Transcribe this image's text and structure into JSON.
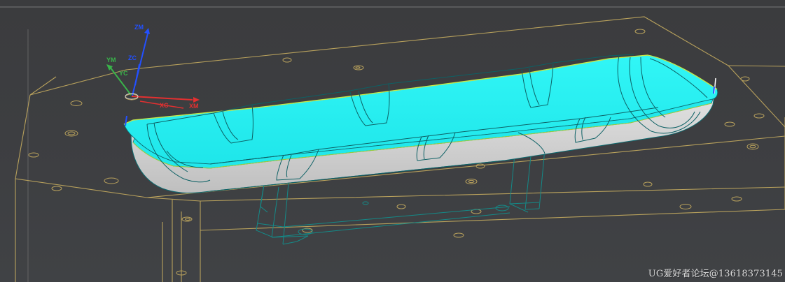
{
  "viewport": {
    "background": "#3c3d3f",
    "box_edge_color": "#b7a15f",
    "part_fill_color": "#28f2f2",
    "part_side_color": "#cfcfcf",
    "part_edge_color": "#0e6b70",
    "wire_color": "#148c8c"
  },
  "triad": {
    "zm": "ZM",
    "zc": "ZC",
    "ym": "YM",
    "yc": "YC",
    "xc": "XC",
    "xm": "XM",
    "x_color": "#e33030",
    "y_color": "#39b34a",
    "z_color": "#2350ff"
  },
  "watermark": {
    "text": "UG爱好者论坛@13618373145"
  }
}
